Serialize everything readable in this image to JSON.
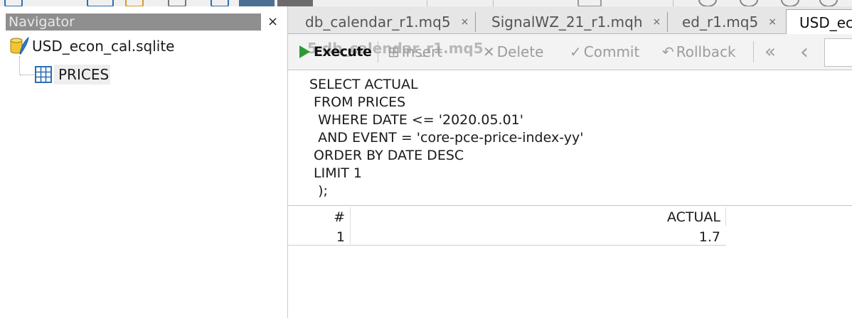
{
  "navigator": {
    "title": "Navigator",
    "close_glyph": "×",
    "database": {
      "label": "USD_econ_cal.sqlite",
      "icon": "database-icon"
    },
    "table": {
      "label": "PRICES",
      "icon": "table-grid-icon"
    }
  },
  "tabs": [
    {
      "label": "db_calendar_r1.mq5",
      "close": "×"
    },
    {
      "label": "SignalWZ_21_r1.mqh",
      "close": "×"
    },
    {
      "label": "ed_r1.mq5",
      "close": "×"
    },
    {
      "label": "USD_ec",
      "active": true
    }
  ],
  "toolbar": {
    "ghost_text": "5 db_calendar_r1.mq5",
    "execute_label": "Execute",
    "insert_label": "Insert",
    "delete_label": "Delete",
    "commit_label": "Commit",
    "rollback_label": "Rollback",
    "first_glyph": "«",
    "prev_glyph": "‹"
  },
  "editor": {
    "sql": "SELECT ACTUAL\n FROM PRICES\n  WHERE DATE <= '2020.05.01'\n  AND EVENT = 'core-pce-price-index-yy'\n ORDER BY DATE DESC\n LIMIT 1\n  );"
  },
  "results": {
    "columns": [
      "#",
      "ACTUAL"
    ],
    "rows": [
      {
        "num": "1",
        "actual": "1.7"
      }
    ]
  }
}
